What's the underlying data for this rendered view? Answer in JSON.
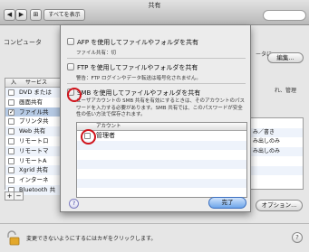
{
  "window": {
    "title": "共有"
  },
  "toolbar": {
    "back": "◀",
    "forward": "▶",
    "grid": "⊞",
    "show_all": "すべてを表示"
  },
  "background": {
    "computer_name_label": "コンピュータ",
    "cut_text_1": "ータに",
    "cut_text_2": "れ、管理",
    "edit_button": "編集...",
    "services_header": {
      "on": "入",
      "service": "サービス"
    },
    "services": [
      {
        "name": "DVD または",
        "checked": false,
        "selected": false
      },
      {
        "name": "画面共有",
        "checked": false,
        "selected": false
      },
      {
        "name": "ファイル共",
        "checked": true,
        "selected": true
      },
      {
        "name": "プリンタ共",
        "checked": false,
        "selected": false
      },
      {
        "name": "Web 共有",
        "checked": false,
        "selected": false
      },
      {
        "name": "リモートロ",
        "checked": false,
        "selected": false
      },
      {
        "name": "リモートマ",
        "checked": false,
        "selected": false
      },
      {
        "name": "リモートA",
        "checked": false,
        "selected": false
      },
      {
        "name": "Xgrid 共有",
        "checked": false,
        "selected": false
      },
      {
        "name": "インターネ",
        "checked": false,
        "selected": false
      },
      {
        "name": "Bluetooth 共",
        "checked": false,
        "selected": false
      }
    ],
    "permissions": [
      "み／書き",
      "み出しのみ",
      "み出しのみ"
    ],
    "add_btn": "+",
    "remove_btn": "−",
    "options_button": "オプション...",
    "help": "?",
    "lock_text": "変更できないようにするにはカギをクリックします。"
  },
  "sheet": {
    "afp": {
      "label": "AFP を使用してファイルやフォルダを共有",
      "sub": "ファイル共有：切"
    },
    "ftp": {
      "label": "FTP を使用してファイルやフォルダを共有",
      "sub": "警告：FTP ログインやデータ転送は暗号化されません。"
    },
    "smb": {
      "label": "SMB を使用してファイルやフォルダを共有",
      "desc": "ユーザアカウントの SMB 共有を有効にするときは、そのアカウントのパスワードを入力する必要があります。SMB 共有では、このパスワードが安全性の低い方法で保存されます。"
    },
    "accounts_header": "アカウント",
    "accounts": [
      {
        "name": "管理者",
        "checked": false
      },
      {
        "name": "",
        "checked": null
      },
      {
        "name": "",
        "checked": null
      },
      {
        "name": "",
        "checked": null
      },
      {
        "name": "",
        "checked": null
      },
      {
        "name": "",
        "checked": null
      },
      {
        "name": "",
        "checked": null
      }
    ],
    "help": "?",
    "done_button": "完了"
  }
}
